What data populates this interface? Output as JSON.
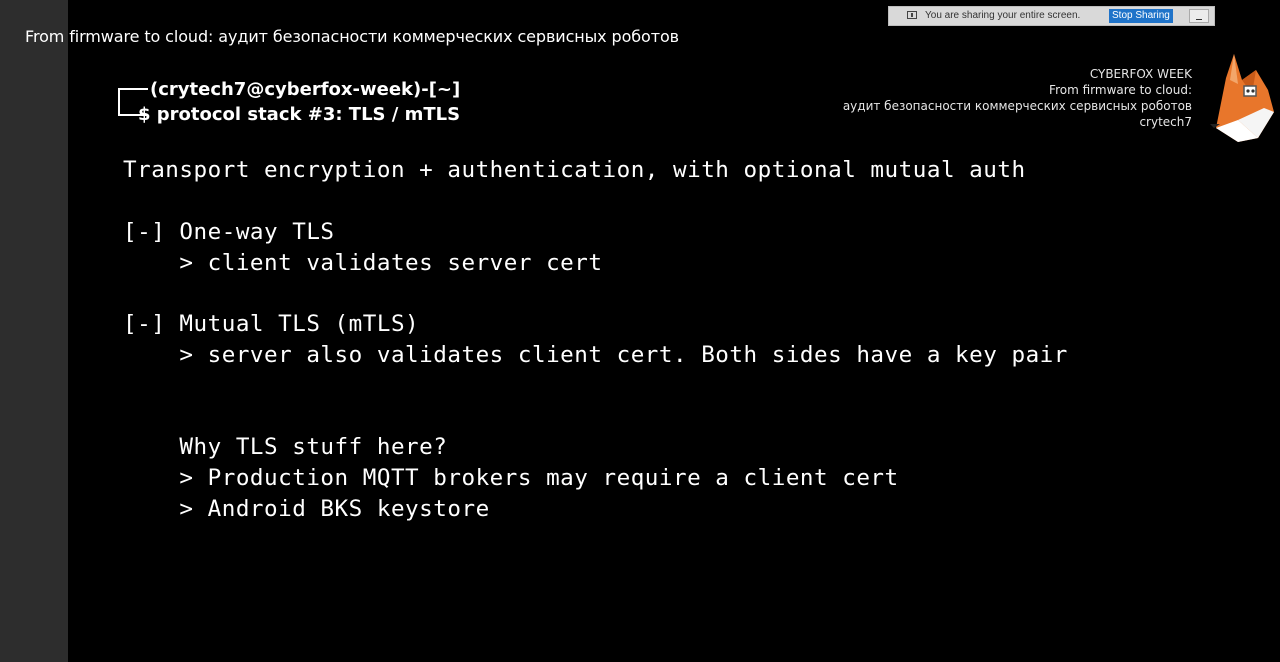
{
  "window": {
    "title": "From firmware to cloud: аудит безопасности коммерческих сервисных роботов"
  },
  "share_bar": {
    "message": "You are sharing your entire screen.",
    "stop_label": "Stop Sharing"
  },
  "slide": {
    "prompt_user": "(crytech7@cyberfox-week)-[~]",
    "prompt_command": "$ protocol stack #3: TLS / mTLS",
    "branding": {
      "line1": "CYBERFOX WEEK",
      "line2": "From firmware to cloud:",
      "line3": "аудит безопасности коммерческих сервисных роботов",
      "line4": "crytech7"
    },
    "subtitle": "Transport encryption + authentication, with optional mutual auth",
    "item1_title": "[-] One-way TLS",
    "item1_detail": "    > client validates server cert",
    "item2_title": "[-] Mutual TLS (mTLS)",
    "item2_detail": "    > server also validates client cert. Both sides have a key pair",
    "why_title": "    Why TLS stuff here?",
    "why_point1": "    > Production MQTT brokers may require a client cert",
    "why_point2": "    > Android BKS keystore"
  },
  "colors": {
    "background": "#000000",
    "left_strip": "#2d2d2d",
    "text": "#ffffff",
    "stop_button": "#1f73c9",
    "fox_orange": "#e8762b"
  }
}
